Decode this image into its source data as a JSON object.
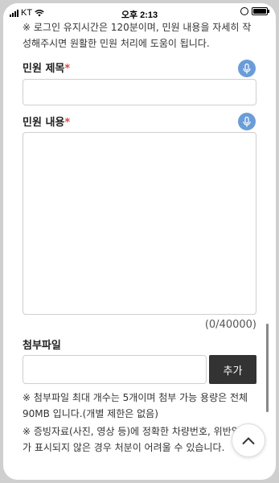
{
  "status_bar": {
    "carrier": "KT",
    "time": "오후 2:13"
  },
  "form": {
    "login_notice": "※ 로그인 유지시간은 120분이며, 민원 내용을 자세히 작성해주시면 원활한 민원 처리에 도움이 됩니다.",
    "title_field": {
      "label": "민원 제목",
      "required_mark": "*",
      "value": ""
    },
    "content_field": {
      "label": "민원 내용",
      "required_mark": "*",
      "value": ""
    },
    "char_counter": "(0/40000)",
    "attachment": {
      "label": "첨부파일",
      "add_button": "추가",
      "value": ""
    },
    "attachment_notice": "※ 첨부파일 최대 개수는 5개이며 첨부 가능 용량은 전체 90MB 입니다.(개별 제한은 없음)",
    "evidence_notice": "※ 증빙자료(사진, 영상 등)에 정확한 차량번호, 위반일시가 표시되지 않은 경우 처분이 어려울 수 있습니다."
  },
  "icons": {
    "mic": "microphone-icon",
    "scroll_top": "chevron-up-icon",
    "accent_color": "#6a9dd8",
    "required_color": "#e2483d"
  }
}
